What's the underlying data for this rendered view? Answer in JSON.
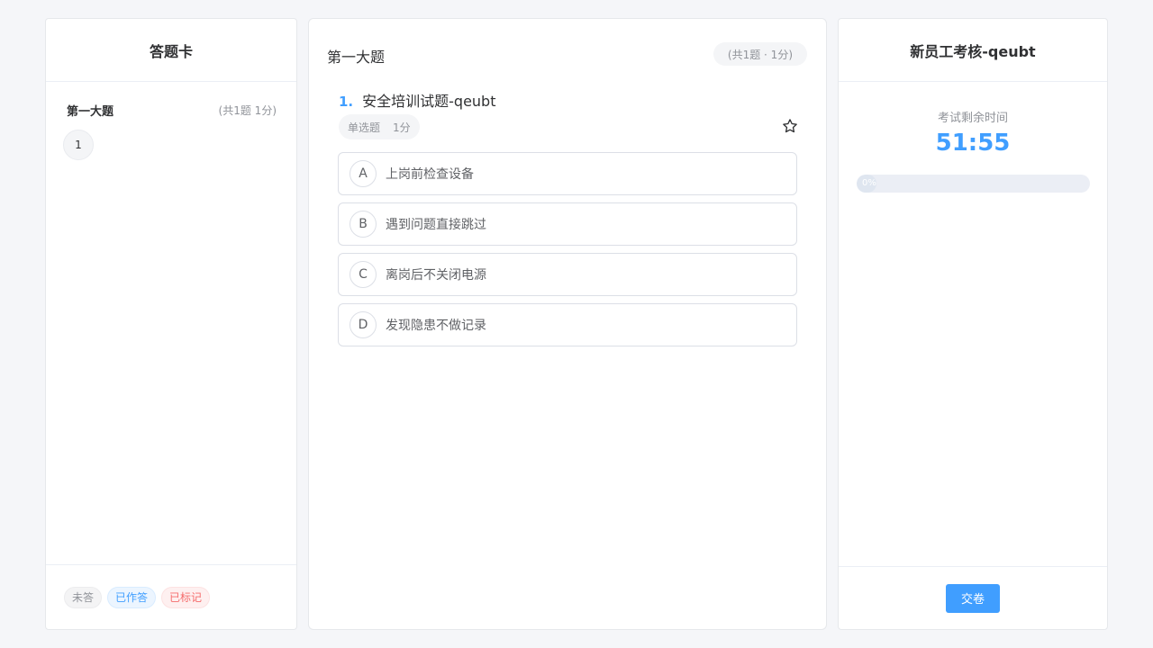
{
  "answer_card": {
    "title": "答题卡",
    "section_title": "第一大题",
    "section_meta": "(共1题 1分)",
    "question_numbers": [
      "1"
    ],
    "legend": {
      "unanswered": "未答",
      "answered": "已作答",
      "marked": "已标记"
    }
  },
  "main": {
    "section_title": "第一大题",
    "section_meta": "(共1题 · 1分)",
    "question": {
      "number": "1.",
      "text": "安全培训试题-qeubt",
      "type": "单选题",
      "score": "1分",
      "star_icon": "star-outline-icon",
      "options": [
        {
          "letter": "A",
          "text": "上岗前检查设备"
        },
        {
          "letter": "B",
          "text": "遇到问题直接跳过"
        },
        {
          "letter": "C",
          "text": "离岗后不关闭电源"
        },
        {
          "letter": "D",
          "text": "发现隐患不做记录"
        }
      ]
    }
  },
  "exam": {
    "title": "新员工考核-qeubt",
    "time_label": "考试剩余时间",
    "time_remaining": "51:55",
    "progress_percent": 0,
    "progress_text": "0%",
    "submit_label": "交卷"
  },
  "colors": {
    "accent": "#409eff",
    "background": "#f5f6f9",
    "marked": "#f56c6c"
  }
}
